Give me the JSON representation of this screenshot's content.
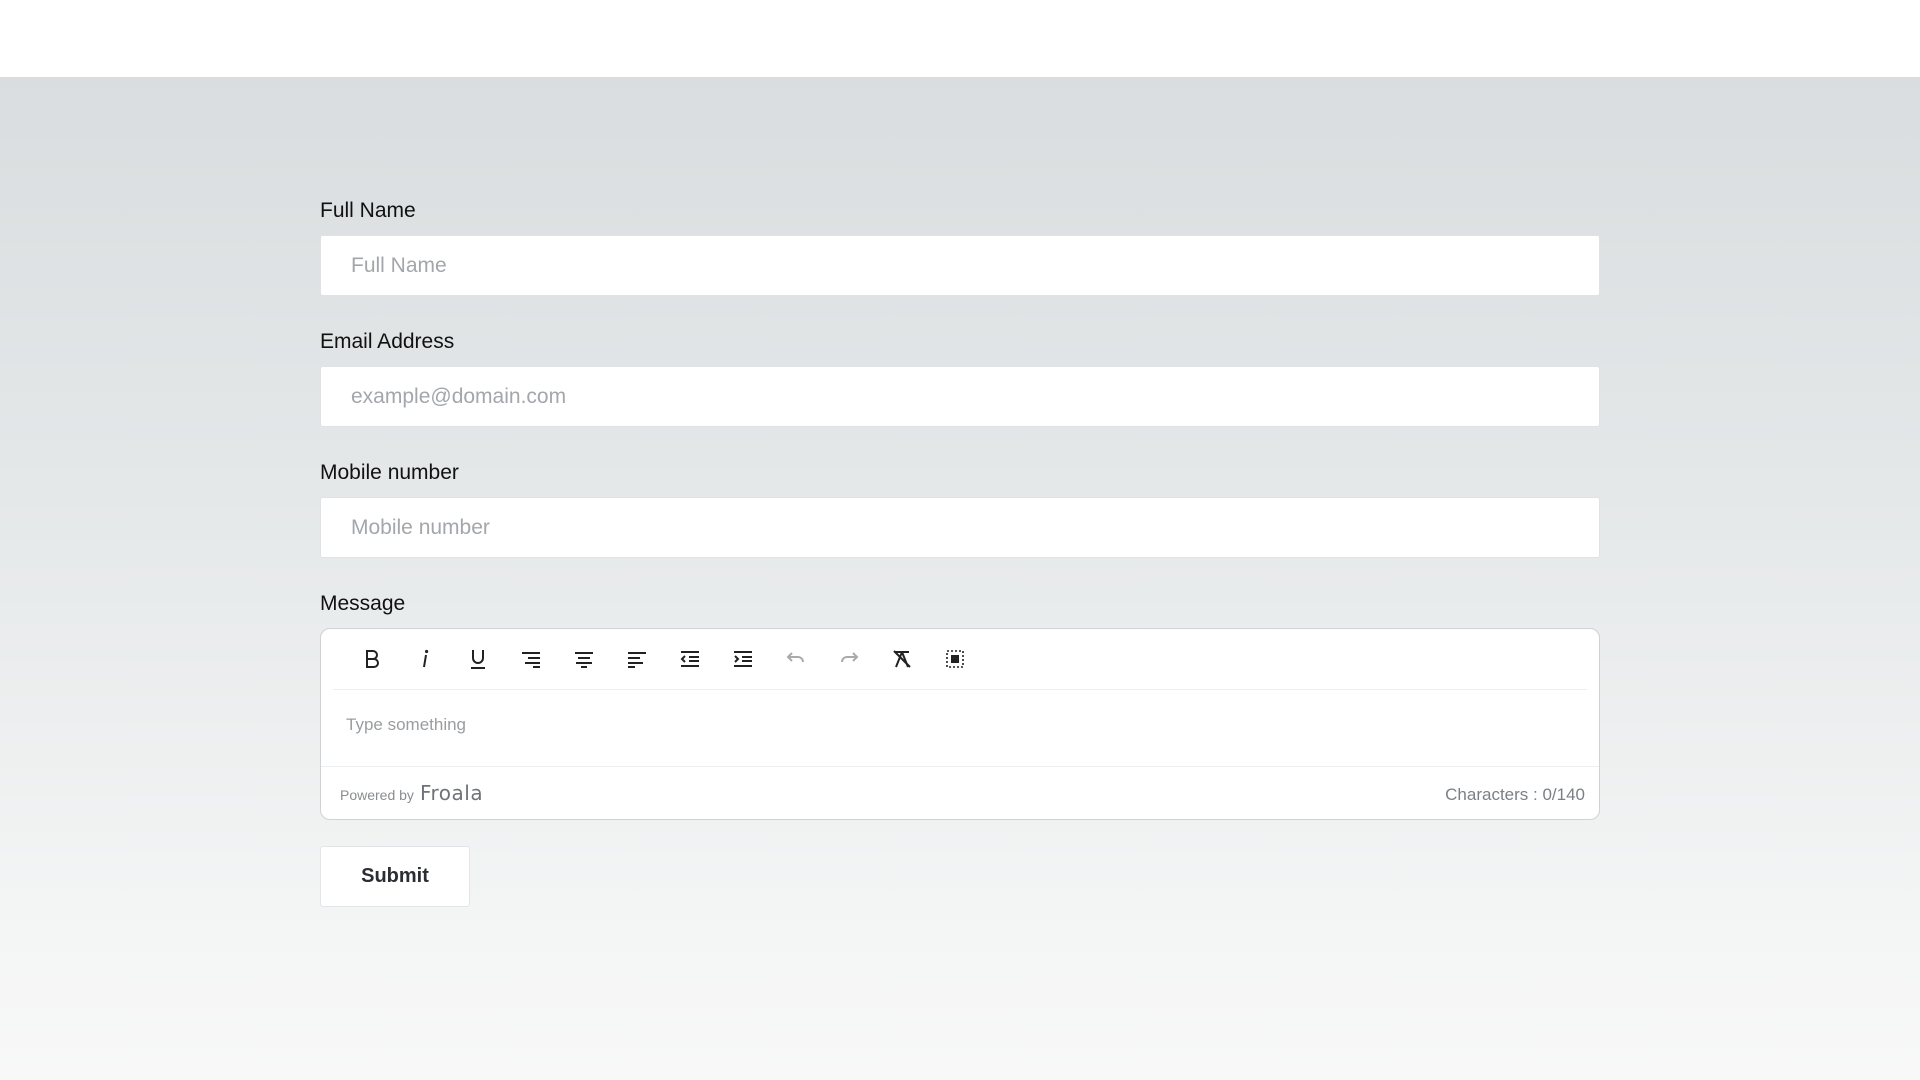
{
  "form": {
    "full_name": {
      "label": "Full Name",
      "placeholder": "Full Name",
      "value": ""
    },
    "email": {
      "label": "Email Address",
      "placeholder": "example@domain.com",
      "value": ""
    },
    "mobile": {
      "label": "Mobile number",
      "placeholder": "Mobile number",
      "value": ""
    },
    "message": {
      "label": "Message",
      "placeholder": "Type something",
      "toolbar": [
        {
          "name": "bold-icon",
          "enabled": true
        },
        {
          "name": "italic-icon",
          "enabled": true
        },
        {
          "name": "underline-icon",
          "enabled": true
        },
        {
          "name": "align-right-icon",
          "enabled": true
        },
        {
          "name": "align-center-icon",
          "enabled": true
        },
        {
          "name": "align-left-icon",
          "enabled": true
        },
        {
          "name": "outdent-icon",
          "enabled": true
        },
        {
          "name": "indent-icon",
          "enabled": true
        },
        {
          "name": "undo-icon",
          "enabled": false
        },
        {
          "name": "redo-icon",
          "enabled": false
        },
        {
          "name": "clear-formatting-icon",
          "enabled": true
        },
        {
          "name": "select-all-icon",
          "enabled": true
        }
      ],
      "powered_by": "Powered by",
      "brand": "Froala",
      "char_count": "Characters : 0/140"
    },
    "submit_label": "Submit"
  },
  "colors": {
    "background_top": "#d9dddf",
    "background_bottom": "#f8f8f8",
    "text": "#111111",
    "placeholder": "#a3a7ab"
  }
}
